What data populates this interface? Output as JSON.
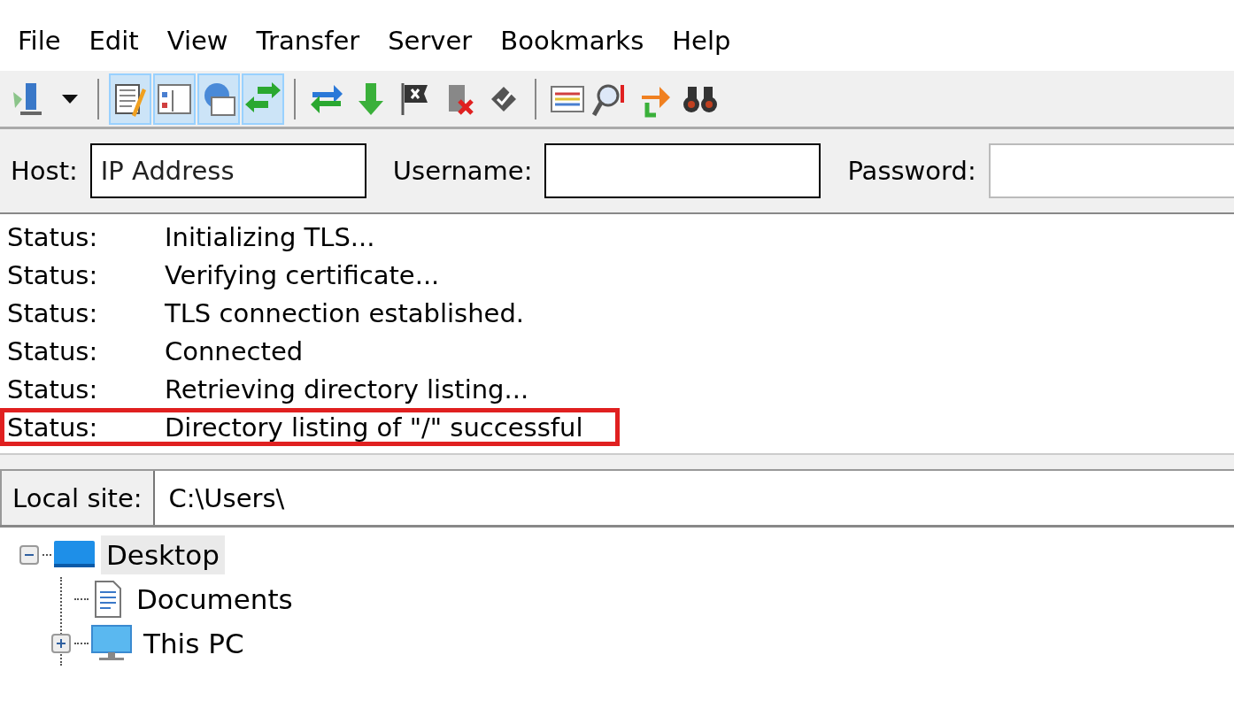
{
  "menu": [
    "File",
    "Edit",
    "View",
    "Transfer",
    "Server",
    "Bookmarks",
    "Help"
  ],
  "toolbar": [
    {
      "kind": "button",
      "pressed": false
    },
    {
      "kind": "dropdown",
      "pressed": false
    },
    {
      "kind": "separator"
    },
    {
      "kind": "button",
      "pressed": true
    },
    {
      "kind": "button",
      "pressed": true
    },
    {
      "kind": "button",
      "pressed": true
    },
    {
      "kind": "button",
      "pressed": true
    },
    {
      "kind": "separator"
    },
    {
      "kind": "button",
      "pressed": false
    },
    {
      "kind": "button",
      "pressed": false
    },
    {
      "kind": "button",
      "pressed": false
    },
    {
      "kind": "button",
      "pressed": false
    },
    {
      "kind": "button",
      "pressed": false
    },
    {
      "kind": "separator"
    },
    {
      "kind": "button",
      "pressed": false
    },
    {
      "kind": "button",
      "pressed": false
    },
    {
      "kind": "button",
      "pressed": false
    },
    {
      "kind": "button",
      "pressed": false
    }
  ],
  "quickconnect": {
    "host_label": "Host:",
    "host_value": "IP Address",
    "username_label": "Username:",
    "password_label": "Password:"
  },
  "log": [
    {
      "type": "Status:",
      "message": "Initializing TLS...",
      "highlighted": false
    },
    {
      "type": "Status:",
      "message": "Verifying certificate...",
      "highlighted": false
    },
    {
      "type": "Status:",
      "message": "TLS connection established.",
      "highlighted": false
    },
    {
      "type": "Status:",
      "message": "Connected",
      "highlighted": false
    },
    {
      "type": "Status:",
      "message": "Retrieving directory listing...",
      "highlighted": false
    },
    {
      "type": "Status:",
      "message": "Directory listing of \"/\" successful",
      "highlighted": true
    }
  ],
  "local_site": {
    "label": "Local site:",
    "path": "C:\\Users\\"
  },
  "tree": [
    {
      "label": "Desktop",
      "kind": "desktop",
      "expanded": true,
      "selected": true,
      "children": [
        {
          "label": "Documents",
          "kind": "documents",
          "selected": false
        },
        {
          "label": "This PC",
          "kind": "pc",
          "expanded": false,
          "selected": false
        }
      ]
    }
  ]
}
